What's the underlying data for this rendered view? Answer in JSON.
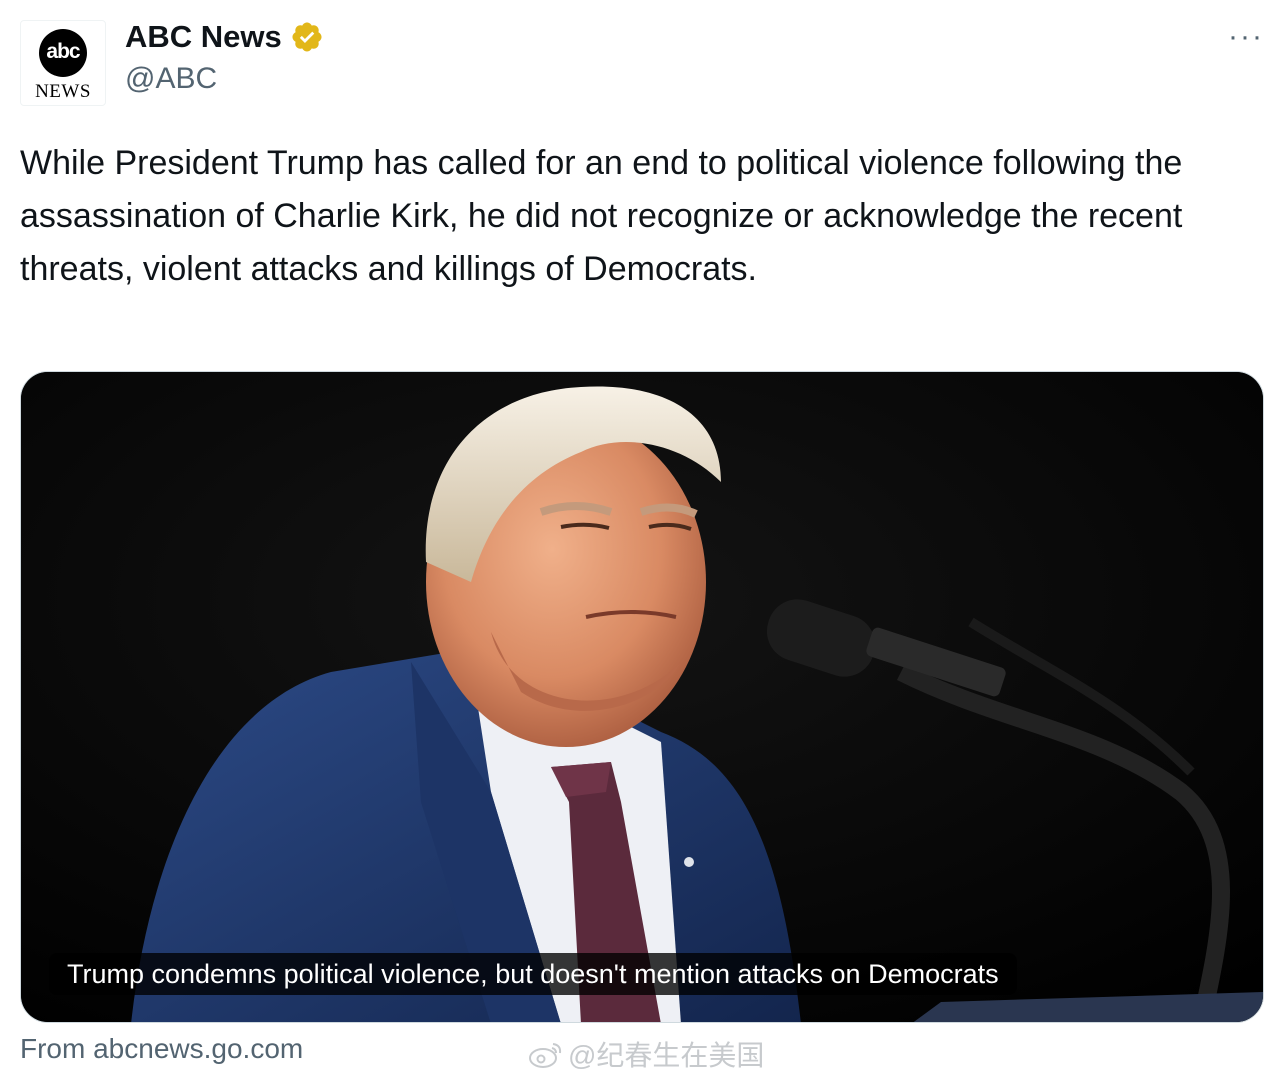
{
  "account": {
    "display_name": "ABC News",
    "handle": "@ABC",
    "avatar_logo_text": "abc",
    "avatar_sub_text": "NEWS",
    "verified_color": "#E2B719"
  },
  "more_label": "···",
  "tweet": {
    "text": "While President Trump has called for an end to political violence following the assassination of Charlie Kirk, he did not recognize or acknowledge the recent threats, violent attacks and killings of Democrats."
  },
  "card": {
    "headline": "Trump condemns political violence, but doesn't mention attacks on Democrats",
    "source": "From abcnews.go.com"
  },
  "watermark": {
    "text": "@纪春生在美国",
    "icon": "weibo-icon"
  }
}
